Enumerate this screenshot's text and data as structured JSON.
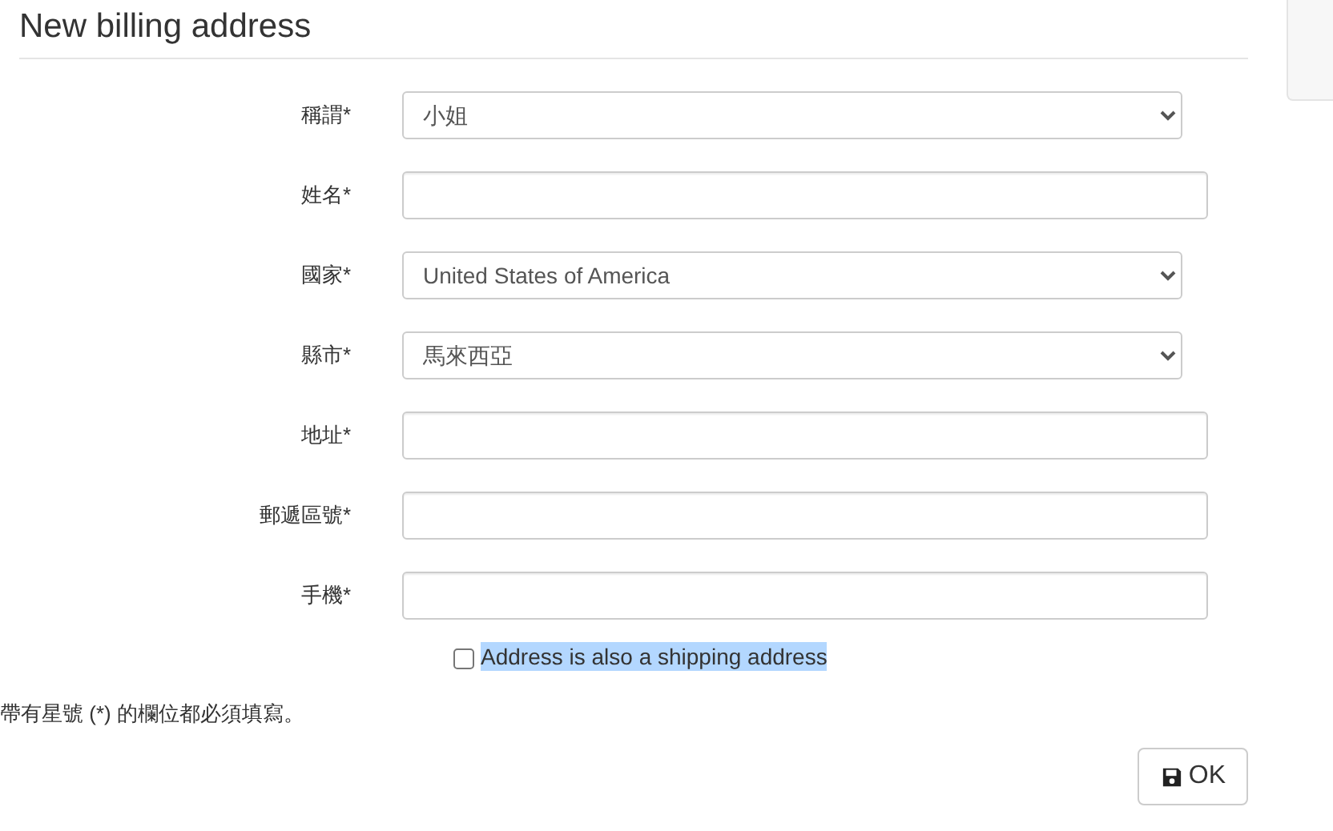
{
  "title": "New billing address",
  "fields": [
    {
      "label": "稱謂*",
      "kind": "select",
      "value": "小姐"
    },
    {
      "label": "姓名*",
      "kind": "input"
    },
    {
      "label": "國家*",
      "kind": "select",
      "value": "United States of America"
    },
    {
      "label": "縣市*",
      "kind": "select",
      "value": "馬來西亞"
    },
    {
      "label": "地址*",
      "kind": "input"
    },
    {
      "label": "郵遞區號*",
      "kind": "input"
    },
    {
      "label": "手機*",
      "kind": "input"
    }
  ],
  "shipping_checkbox": {
    "label": "Address is also a shipping address",
    "checked": false,
    "highlighted": true
  },
  "footnote": "帶有星號 (*) 的欄位都必須填寫。",
  "ok_button": {
    "label": "OK"
  }
}
